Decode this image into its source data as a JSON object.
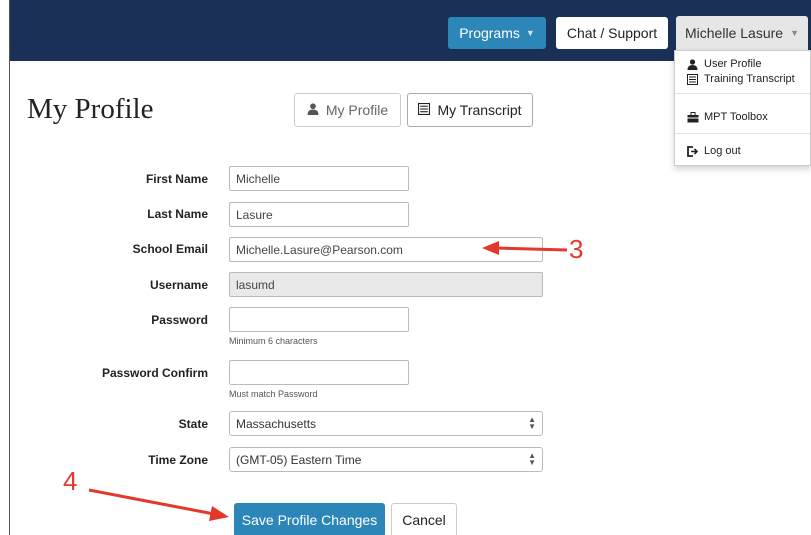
{
  "header": {
    "programs_label": "Programs",
    "chat_label": "Chat / Support",
    "user_label": "Michelle Lasure"
  },
  "user_menu": {
    "items": [
      {
        "label": "User Profile",
        "icon": "user-icon"
      },
      {
        "label": "Training Transcript",
        "icon": "list-icon"
      },
      {
        "label": "MPT Toolbox",
        "icon": "toolbox-icon"
      },
      {
        "label": "Log out",
        "icon": "logout-icon"
      }
    ]
  },
  "page": {
    "title": "My Profile",
    "tabs": [
      {
        "label": "My Profile",
        "icon": "user-icon"
      },
      {
        "label": "My Transcript",
        "icon": "list-icon"
      }
    ]
  },
  "form": {
    "first_name": {
      "label": "First Name",
      "value": "Michelle"
    },
    "last_name": {
      "label": "Last Name",
      "value": "Lasure"
    },
    "school_email": {
      "label": "School Email",
      "value": "Michelle.Lasure@Pearson.com"
    },
    "username": {
      "label": "Username",
      "value": "lasumd"
    },
    "password": {
      "label": "Password",
      "value": "",
      "help": "Minimum 6 characters"
    },
    "password_confirm": {
      "label": "Password Confirm",
      "value": "",
      "help": "Must match Password"
    },
    "state": {
      "label": "State",
      "value": "Massachusetts"
    },
    "time_zone": {
      "label": "Time Zone",
      "value": "(GMT-05) Eastern Time"
    },
    "save_label": "Save Profile Changes",
    "cancel_label": "Cancel"
  },
  "annotations": {
    "marker_3": "3",
    "marker_4": "4",
    "color": "#e3382a"
  }
}
